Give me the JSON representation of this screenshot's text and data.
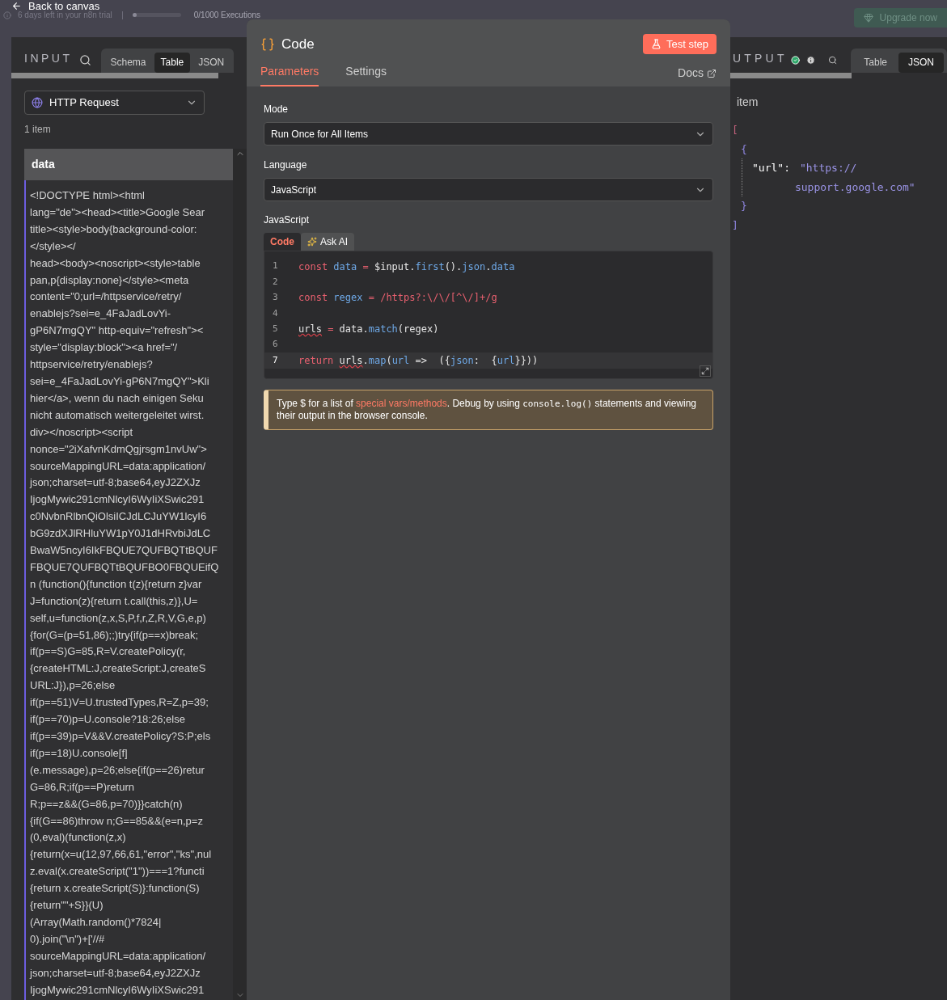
{
  "top_bar": {
    "back_link": "Back to canvas",
    "trial_text": "6 days left in your n8n trial",
    "executions": {
      "label": "0/1000 Executions",
      "level": 0
    },
    "upgrade_button": "Upgrade now"
  },
  "input_panel": {
    "title": "INPUT",
    "view_tabs": [
      {
        "label": "Schema",
        "selected": false
      },
      {
        "label": "Table",
        "selected": true
      },
      {
        "label": "JSON",
        "selected": false
      }
    ],
    "source": "HTTP Request",
    "item_count": "1 item",
    "column": "data",
    "lines": [
      "<!DOCTYPE html><html",
      "lang=\"de\"><head><title>Google Sear",
      "title><style>body{background-color:",
      "</style></",
      "head><body><noscript><style>table",
      "pan,p{display:none}</style><meta",
      "content=\"0;url=/httpservice/retry/",
      "enablejs?sei=e_4FaJadLovYi-",
      "gP6N7mgQY\" http-equiv=\"refresh\"><",
      "style=\"display:block\"><a href=\"/",
      "httpservice/retry/enablejs?",
      "sei=e_4FaJadLovYi-gP6N7mgQY\">Kli",
      "hier</a>, wenn du nach einigen Seku",
      "nicht automatisch weitergeleitet wirst.",
      "div></noscript><script",
      "nonce=\"2iXafvnKdmQgjrsgm1nvUw\">",
      "sourceMappingURL=data:application/",
      "json;charset=utf-8;base64,eyJ2ZXJz",
      "IjogMywic291cmNlcyI6WyIiXSwic291",
      "c0NvbnRlbnQiOlsiICJdLCJuYW1lcyI6",
      "bG9zdXJlRHluYW1pY0J1dHRvbiJdLC",
      "BwaW5ncyI6IkFBQUE7QUFBQTtBQUF",
      "FBQUE7QUFBQTtBQUFBO0FBQUEifQ",
      "n (function(){function t(z){return z}var",
      "J=function(z){return t.call(this,z)},U=",
      "self,u=function(z,x,S,P,f,r,Z,R,V,G,e,p)",
      "{for(G=(p=51,86);;)try{if(p==x)break;",
      "if(p==S)G=85,R=V.createPolicy(r,",
      "{createHTML:J,createScript:J,createS",
      "URL:J}),p=26;else",
      "if(p==51)V=U.trustedTypes,R=Z,p=39;",
      "if(p==70)p=U.console?18:26;else",
      "if(p==39)p=V&&V.createPolicy?S:P;els",
      "if(p==18)U.console[f]",
      "(e.message),p=26;else{if(p==26)retur",
      "G=86,R;if(p==P)return",
      "R;p==z&&(G=86,p=70)}}catch(n)",
      "{if(G==86)throw n;G==85&&(e=n,p=z",
      "(0,eval)(function(z,x)",
      "{return(x=u(12,97,66,61,\"error\",\"ks\",nul",
      "z.eval(x.createScript(\"1\"))===1?functi",
      "{return x.createScript(S)}:function(S)",
      "{return\"\"+S}}(U)",
      "(Array(Math.random()*7824|",
      "0).join(\"\\n\")+['//#",
      "sourceMappingURL=data:application/",
      "json;charset=utf-8;base64,eyJ2ZXJz",
      "IjogMywic291cmNlcyI6WyIiXSwic291"
    ]
  },
  "node_modal": {
    "title": "Code",
    "test_button": "Test step",
    "tabs": [
      {
        "label": "Parameters",
        "selected": true
      },
      {
        "label": "Settings",
        "selected": false
      }
    ],
    "docs_link": "Docs",
    "fields": [
      {
        "label": "Mode",
        "value": "Run Once for All Items"
      },
      {
        "label": "Language",
        "value": "JavaScript"
      }
    ],
    "editor": {
      "label": "JavaScript",
      "tabs": [
        {
          "label": "Code",
          "selected": true
        },
        {
          "label": "Ask AI",
          "selected": false
        }
      ],
      "lines": [
        {
          "number": "1",
          "active": false,
          "tokens": [
            {
              "kind": "keyword",
              "text": "const "
            },
            {
              "kind": "name",
              "text": "data "
            },
            {
              "kind": "keyword",
              "text": "= "
            },
            {
              "kind": "plain",
              "text": "$input."
            },
            {
              "kind": "name",
              "text": "first"
            },
            {
              "kind": "plain",
              "text": "()."
            },
            {
              "kind": "name",
              "text": "json"
            },
            {
              "kind": "plain",
              "text": "."
            },
            {
              "kind": "name",
              "text": "data"
            }
          ]
        },
        {
          "number": "2",
          "active": false
        },
        {
          "number": "3",
          "active": false,
          "tokens": [
            {
              "kind": "keyword",
              "text": "const "
            },
            {
              "kind": "name",
              "text": "regex "
            },
            {
              "kind": "keyword",
              "text": "= /https?:\\/\\/[^\\/]+/g"
            }
          ]
        },
        {
          "number": "4",
          "active": false
        },
        {
          "number": "5",
          "active": false,
          "tokens": [
            {
              "kind": "flagged",
              "text": "urls"
            },
            {
              "kind": "keyword",
              "text": " = "
            },
            {
              "kind": "plain",
              "text": "data."
            },
            {
              "kind": "name",
              "text": "match"
            },
            {
              "kind": "plain",
              "text": "(regex)"
            }
          ]
        },
        {
          "number": "6",
          "active": false
        },
        {
          "number": "7",
          "active": true,
          "tokens": [
            {
              "kind": "keyword",
              "text": "return "
            },
            {
              "kind": "flagged",
              "text": "urls"
            },
            {
              "kind": "plain",
              "text": "."
            },
            {
              "kind": "name",
              "text": "map"
            },
            {
              "kind": "plain",
              "text": "("
            },
            {
              "kind": "name",
              "text": "url"
            },
            {
              "kind": "plain",
              "text": " =>  ({"
            },
            {
              "kind": "name",
              "text": "json"
            },
            {
              "kind": "plain",
              "text": ":  {"
            },
            {
              "kind": "name",
              "text": "url"
            },
            {
              "kind": "plain",
              "text": "}}))"
            }
          ]
        }
      ]
    },
    "hint": [
      {
        "kind": "text",
        "text": "Type $ for a list of "
      },
      {
        "kind": "link",
        "text": "special vars/methods"
      },
      {
        "kind": "text",
        "text": ". Debug by using "
      },
      {
        "kind": "code",
        "text": "console.log()"
      },
      {
        "kind": "text",
        "text": " statements and viewing their output in the browser console."
      }
    ]
  },
  "output_panel": {
    "title": "UTPUT",
    "view_tabs": [
      {
        "label": "Table",
        "selected": false
      },
      {
        "label": "JSON",
        "selected": true
      }
    ],
    "item_count": "item",
    "json": {
      "open": "[",
      "object_open": "{",
      "key": "\"url\":",
      "value_lines": [
        "\"https://",
        "support.google.com\""
      ],
      "object_close": "}",
      "close": "]"
    }
  }
}
